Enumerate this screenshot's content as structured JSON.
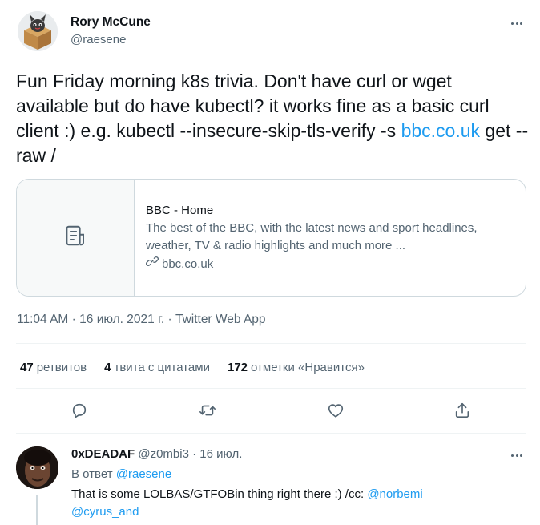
{
  "tweet": {
    "author_name": "Rory McCune",
    "author_handle": "@raesene",
    "text_main": "Fun Friday morning k8s trivia. Don't have curl or wget available but do have kubectl? it works fine as a basic curl client :) e.g. kubectl --insecure-skip-tls-verify -s ",
    "text_link": "bbc.co.uk",
    "text_tail": " get --raw /",
    "card": {
      "title": "BBC - Home",
      "description": "The best of the BBC, with the latest news and sport headlines, weather, TV & radio highlights and much more ...",
      "domain": "bbc.co.uk"
    },
    "time": "11:04 AM",
    "date": "16 июл. 2021 г.",
    "source": "Twitter Web App",
    "separator": "·"
  },
  "stats": {
    "retweets_count": "47",
    "retweets_label": "ретвитов",
    "quotes_count": "4",
    "quotes_label": "твита с цитатами",
    "likes_count": "172",
    "likes_label": "отметки «Нравится»"
  },
  "reply": {
    "author_name": "0xDEADAF",
    "author_handle": "@z0mbi3",
    "separator": "·",
    "date": "16 июл.",
    "replying_to_prefix": "В ответ",
    "replying_to_handle": "@raesene",
    "text_main": "That is some LOLBAS/GTFOBin thing right there :) /cc: ",
    "mention_1": "@norbemi",
    "mention_2": "@cyrus_and"
  },
  "icons": {
    "more": "more-horizontal-icon",
    "article": "article-icon",
    "link": "link-icon",
    "reply": "reply-icon",
    "retweet": "retweet-icon",
    "like": "heart-icon",
    "share": "share-icon"
  },
  "colors": {
    "accent": "#1d9bf0",
    "text": "#0f1419",
    "muted": "#536471",
    "border": "#cfd9de",
    "divider": "#eff3f4"
  }
}
